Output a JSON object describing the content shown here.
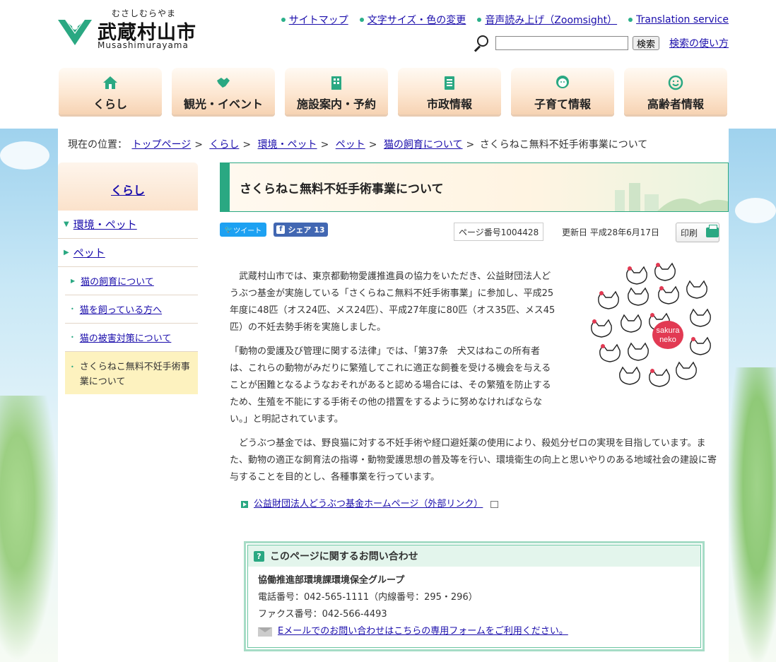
{
  "header": {
    "logo_kana": "むさしむらやま",
    "logo_kanji": "武蔵村山市",
    "logo_roman": "Musashimurayama",
    "util_links": [
      {
        "label": "サイトマップ"
      },
      {
        "label": "文字サイズ・色の変更"
      },
      {
        "label": "音声読み上げ（Zoomsight）"
      },
      {
        "label": "Translation service"
      }
    ],
    "search_button": "検索",
    "search_help": "検索の使い方",
    "search_value": ""
  },
  "gnav": [
    {
      "label": "くらし"
    },
    {
      "label": "観光・イベント"
    },
    {
      "label": "施設案内・予約"
    },
    {
      "label": "市政情報"
    },
    {
      "label": "子育て情報"
    },
    {
      "label": "高齢者情報"
    }
  ],
  "breadcrumb": {
    "prefix": "現在の位置：",
    "items": [
      "トップページ",
      "くらし",
      "環境・ペット",
      "ペット",
      "猫の飼育について"
    ],
    "current": "さくらねこ無料不妊手術事業について",
    "separator": ">"
  },
  "sidebar": {
    "heading": "くらし",
    "level1": [
      "環境・ペット",
      "ペット"
    ],
    "level2": [
      "猫の飼育について",
      "猫を飼っている方へ",
      "猫の被害対策について"
    ],
    "current": "さくらねこ無料不妊手術事業について"
  },
  "main": {
    "title": "さくらねこ無料不妊手術事業について",
    "tweet": "ツイート",
    "share": "シェア 13",
    "page_no": "ページ番号1004428",
    "updated": "更新日 平成28年6月17日",
    "print": "印刷",
    "cat_badge_1": "sakura",
    "cat_badge_2": "neko",
    "p1": "武蔵村山市では、東京都動物愛護推進員の協力をいただき、公益財団法人どうぶつ基金が実施している「さくらねこ無料不妊手術事業」に参加し、平成25年度に48匹（オス24匹、メス24匹）、平成27年度に80匹（オス35匹、メス45匹）の不妊去勢手術を実施しました。",
    "p2": "「動物の愛護及び管理に関する法律」では、「第37条　犬又はねこの所有者は、これらの動物がみだりに繁殖してこれに適正な飼養を受ける機会を与えることが困難となるようなおそれがあると認める場合には、その繁殖を防止するため、生殖を不能にする手術その他の措置をするように努めなければならない。」と明記されています。",
    "p3": "どうぶつ基金では、野良猫に対する不妊手術や経口避妊薬の使用により、殺処分ゼロの実現を目指しています。また、動物の適正な飼育法の指導・動物愛護思想の普及等を行い、環境衛生の向上と思いやりのある地域社会の建設に寄与することを目的とし、各種事業を行っています。",
    "ext_link": "公益財団法人どうぶつ基金ホームページ（外部リンク）"
  },
  "contact": {
    "heading": "このページに関するお問い合わせ",
    "dept": "協働推進部環境課環境保全グループ",
    "tel": "電話番号：042-565-1111（内線番号：295・296）",
    "fax": "ファクス番号：042-566-4493",
    "mail": "Eメールでのお問い合わせはこちらの専用フォームをご利用ください。"
  },
  "colors": {
    "accent": "#2aa882",
    "nav_bg": "#fde7d2",
    "current_bg": "#fdf2bf"
  }
}
